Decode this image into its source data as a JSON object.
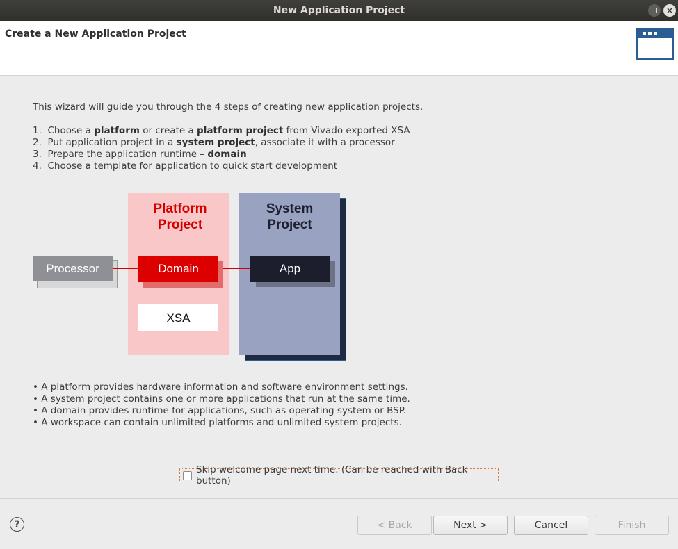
{
  "window": {
    "title": "New Application Project",
    "max_icon": "maximize-icon",
    "close_icon": "close-icon",
    "close_glyph": "×"
  },
  "header": {
    "title": "Create a New Application Project",
    "icon": "wizard-window-icon"
  },
  "intro": "This wizard will guide you through the 4 steps of creating new application projects.",
  "steps": [
    {
      "num": "1.",
      "parts": [
        "Choose a ",
        "platform",
        " or create a ",
        "platform project",
        " from Vivado exported XSA"
      ]
    },
    {
      "num": "2.",
      "parts": [
        "Put application project in a ",
        "system project",
        ", associate it with a processor"
      ]
    },
    {
      "num": "3.",
      "parts": [
        "Prepare the application runtime – ",
        "domain"
      ]
    },
    {
      "num": "4.",
      "parts": [
        "Choose a template for application to quick start development"
      ]
    }
  ],
  "diagram": {
    "platform_title_line1": "Platform",
    "platform_title_line2": "Project",
    "system_title_line1": "System",
    "system_title_line2": "Project",
    "processor": "Processor",
    "domain": "Domain",
    "app": "App",
    "xsa": "XSA"
  },
  "bullets": [
    "• A platform provides hardware information and software environment settings.",
    "• A system project contains one or more applications that run at the same time.",
    "• A domain provides runtime for applications, such as operating system or BSP.",
    "• A workspace can contain unlimited platforms and unlimited system projects."
  ],
  "skip_checkbox": {
    "label": "Skip welcome page next time. (Can be reached with Back button)",
    "checked": false
  },
  "footer": {
    "help_glyph": "?",
    "back": "< Back",
    "next": "Next >",
    "cancel": "Cancel",
    "finish": "Finish"
  }
}
